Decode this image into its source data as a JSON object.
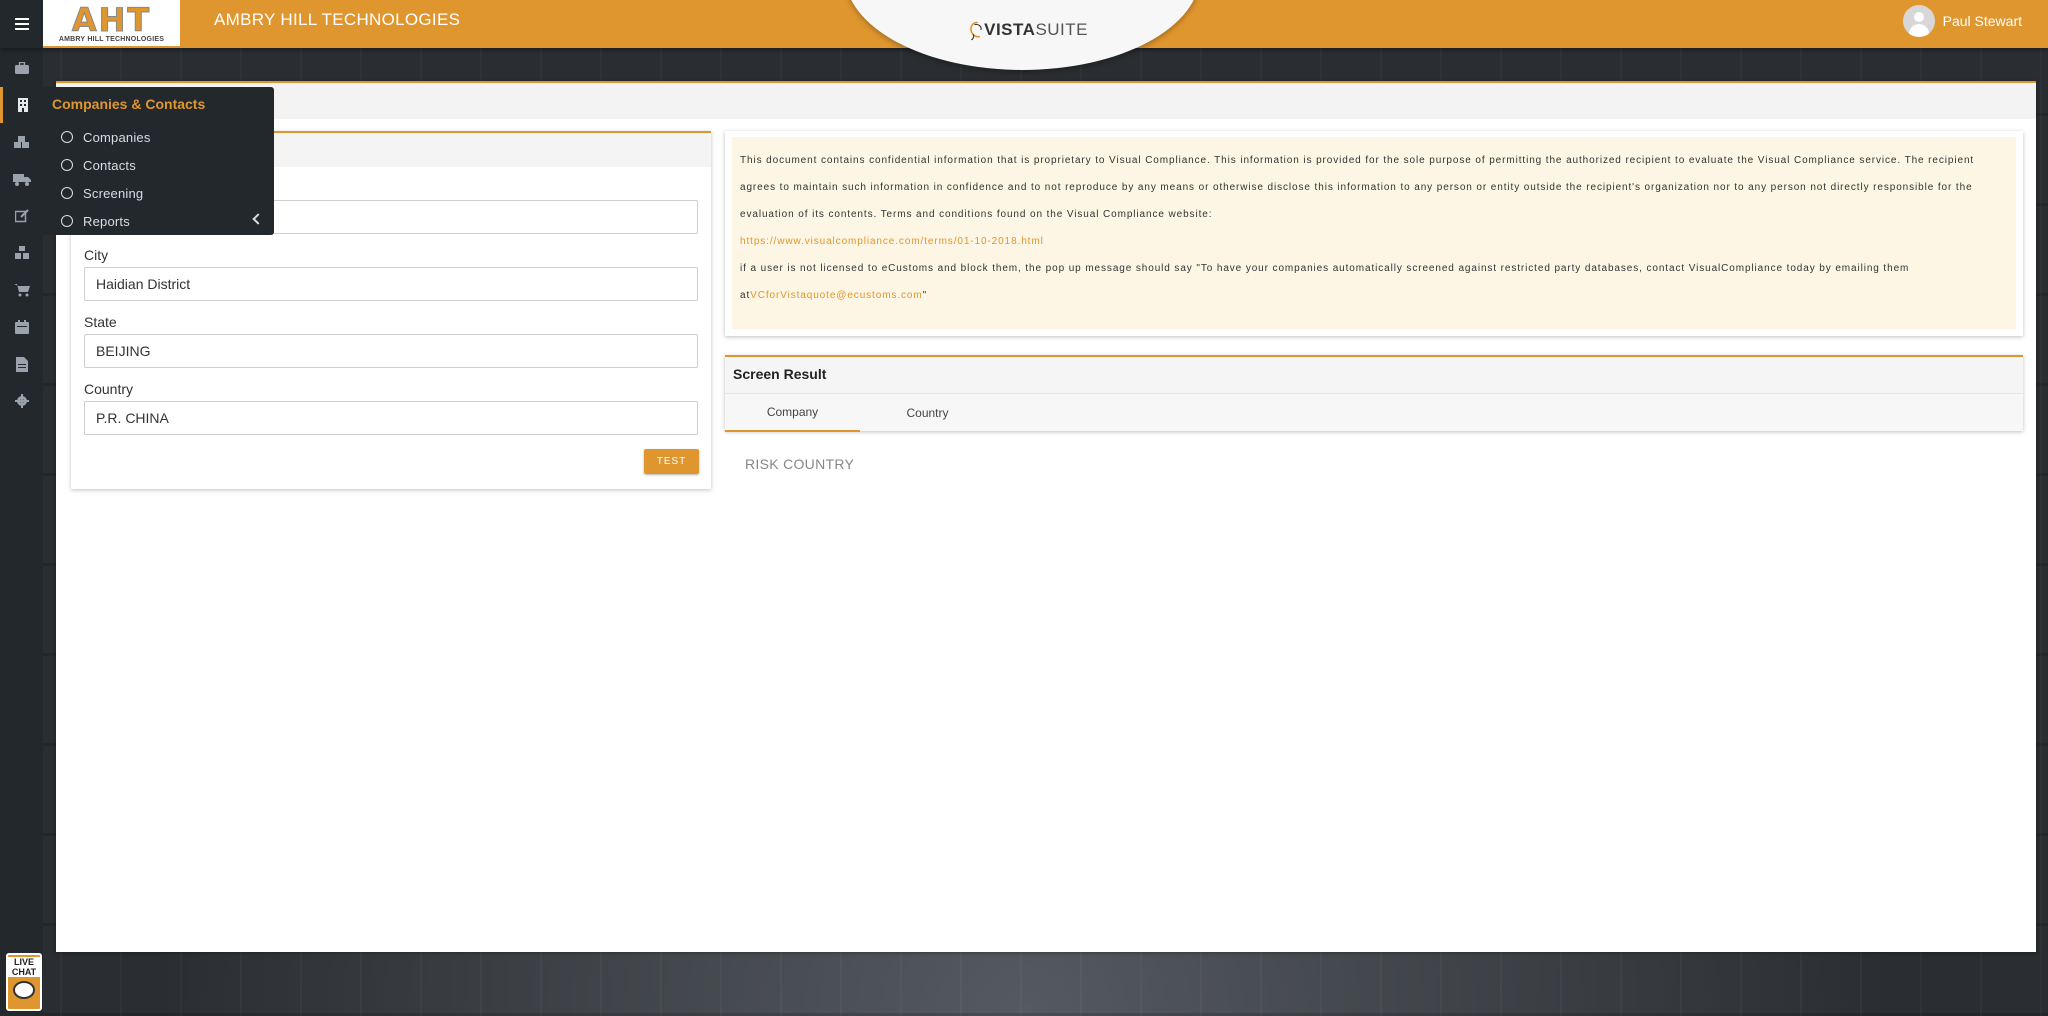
{
  "header": {
    "company_name": "AMBRY HILL TECHNOLOGIES",
    "logo_letters": "AHT",
    "logo_subtitle": "AMBRY HILL TECHNOLOGIES",
    "product_brand_bold": "VISTA",
    "product_brand_light": "SUITE",
    "user_name": "Paul Stewart",
    "brand_color": "#e0962e"
  },
  "rail": {
    "icons": [
      "home-icon",
      "building-icon",
      "cubes-icon",
      "truck-icon",
      "edit-icon",
      "warehouse-icon",
      "cart-icon",
      "calendar-icon",
      "document-icon",
      "gear-icon"
    ],
    "active": "building-icon"
  },
  "flyout": {
    "title": "Companies & Contacts",
    "items": [
      {
        "label": "Companies"
      },
      {
        "label": "Contacts"
      },
      {
        "label": "Screening"
      },
      {
        "label": "Reports"
      }
    ]
  },
  "form": {
    "top_field_value": "",
    "city_label": "City",
    "city_value": "Haidian District",
    "state_label": "State",
    "state_value": "BEIJING",
    "country_label": "Country",
    "country_value": "P.R. CHINA",
    "test_button": "TEST"
  },
  "notice": {
    "paragraph_1": "This document contains confidential information that is proprietary to Visual Compliance. This information is provided for the sole purpose of permitting the authorized recipient to evaluate the Visual Compliance service. The recipient agrees to maintain such information in confidence and to not reproduce by any means or otherwise disclose this information to any person or entity outside the recipient's organization nor to any person not directly responsible for the evaluation of its contents. Terms and conditions found on the Visual Compliance website:",
    "terms_link": "https://www.visualcompliance.com/terms/01-10-2018.html",
    "paragraph_2_prefix": "if a user is not licensed to eCustoms and block them, the pop up message should say \"To have your companies automatically screened against restricted party databases, contact VisualCompliance today by emailing them at",
    "email_link": "VCforVistaquote@ecustoms.com",
    "paragraph_2_suffix": "\""
  },
  "screen_result": {
    "title": "Screen Result",
    "tabs": [
      {
        "label": "Company",
        "active": true
      },
      {
        "label": "Country",
        "active": false
      }
    ],
    "risk_label": "RISK COUNTRY"
  },
  "live_chat": {
    "label": "LIVE CHAT"
  }
}
